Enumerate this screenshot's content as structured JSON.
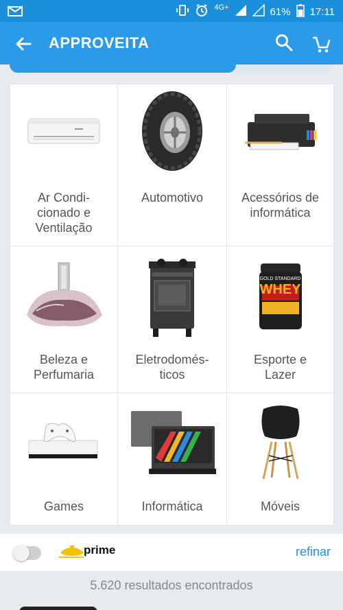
{
  "status_bar": {
    "network": "4G+",
    "battery": "61%",
    "time": "17:11"
  },
  "app_bar": {
    "title": "APPROVEITA"
  },
  "categories": [
    {
      "label": "Ar Condi-\ncionado e\nVentilação",
      "icon": "air-conditioner-image"
    },
    {
      "label": "Automotivo",
      "icon": "tire-image"
    },
    {
      "label": "Acessórios de\ninformática",
      "icon": "printer-image"
    },
    {
      "label": "Beleza e\nPerfumaria",
      "icon": "perfume-image"
    },
    {
      "label": "Eletrodomés-\nticos",
      "icon": "stove-image"
    },
    {
      "label": "Esporte e\nLazer",
      "icon": "whey-protein-image"
    },
    {
      "label": "Games",
      "icon": "xbox-console-image"
    },
    {
      "label": "Informática",
      "icon": "laptop-image"
    },
    {
      "label": "Móveis",
      "icon": "chair-image"
    }
  ],
  "products": {
    "whey_brand": "WHEY",
    "whey_subtitle": "GOLD STANDARD"
  },
  "filter_bar": {
    "prime_label": "prime",
    "prime_enabled": false,
    "refine_label": "refinar"
  },
  "results": {
    "text": "5.620 resultados encontrados"
  },
  "colors": {
    "primary": "#2b9ae8",
    "status_bar": "#1a8fdb",
    "accent_text": "#2b8fd9",
    "prime_yellow": "#f5c400"
  },
  "scroll_progress": 0.7
}
